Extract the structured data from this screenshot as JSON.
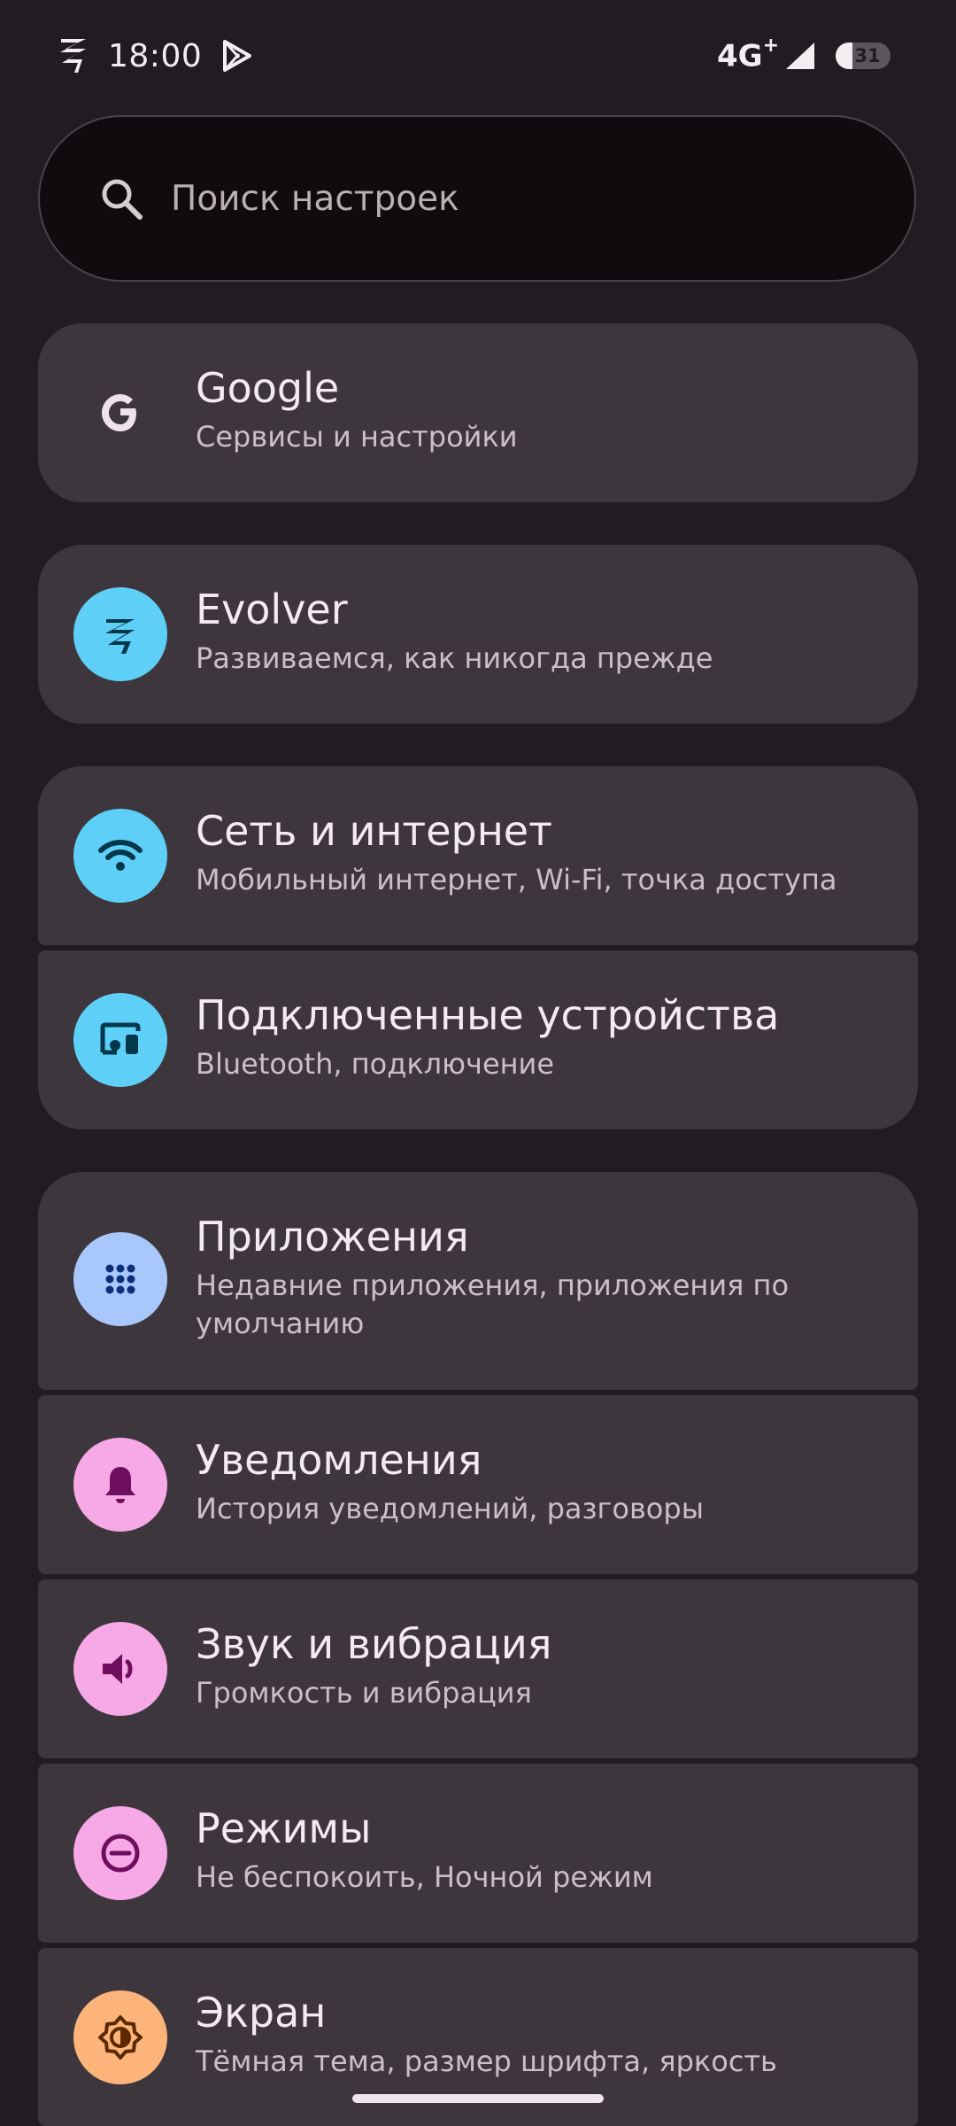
{
  "status_bar": {
    "time": "18:00",
    "network_type": "4G",
    "network_plus": "+",
    "battery_level": "31",
    "battery_fraction": 0.31
  },
  "search": {
    "placeholder": "Поиск настроек",
    "icon": "search-icon"
  },
  "settings": [
    {
      "title": "Google",
      "subtitle": "Сервисы и настройки",
      "icon": "google-icon",
      "icon_bg": "#3d363d",
      "icon_color": "#ede3e9"
    },
    {
      "title": "Evolver",
      "subtitle": "Развиваемся, как никогда прежде",
      "icon": "evolver-logo-icon",
      "icon_bg": "#5ecff7",
      "icon_color": "#00374a"
    },
    {
      "title": "Сеть и интернет",
      "subtitle": "Мобильный интернет, Wi-Fi, точка доступа",
      "icon": "wifi-icon",
      "icon_bg": "#5ecff7",
      "icon_color": "#00374a"
    },
    {
      "title": "Подключенные устройства",
      "subtitle": "Bluetooth, подключение",
      "icon": "devices-icon",
      "icon_bg": "#5ecff7",
      "icon_color": "#00374a"
    },
    {
      "title": "Приложения",
      "subtitle": "Недавние приложения, приложения по умолчанию",
      "icon": "apps-grid-icon",
      "icon_bg": "#a8c7fa",
      "icon_color": "#0b2f78"
    },
    {
      "title": "Уведомления",
      "subtitle": "История уведомлений, разговоры",
      "icon": "bell-icon",
      "icon_bg": "#f7a8e6",
      "icon_color": "#6e0e5c"
    },
    {
      "title": "Звук и вибрация",
      "subtitle": "Громкость и вибрация",
      "icon": "volume-icon",
      "icon_bg": "#f7a8e6",
      "icon_color": "#6e0e5c"
    },
    {
      "title": "Режимы",
      "subtitle": "Не беспокоить, Ночной режим",
      "icon": "do-not-disturb-icon",
      "icon_bg": "#f7a8e6",
      "icon_color": "#6e0e5c"
    },
    {
      "title": "Экран",
      "subtitle": "Тёмная тема, размер шрифта, яркость",
      "icon": "brightness-icon",
      "icon_bg": "#fcb47a",
      "icon_color": "#5c2800"
    }
  ]
}
